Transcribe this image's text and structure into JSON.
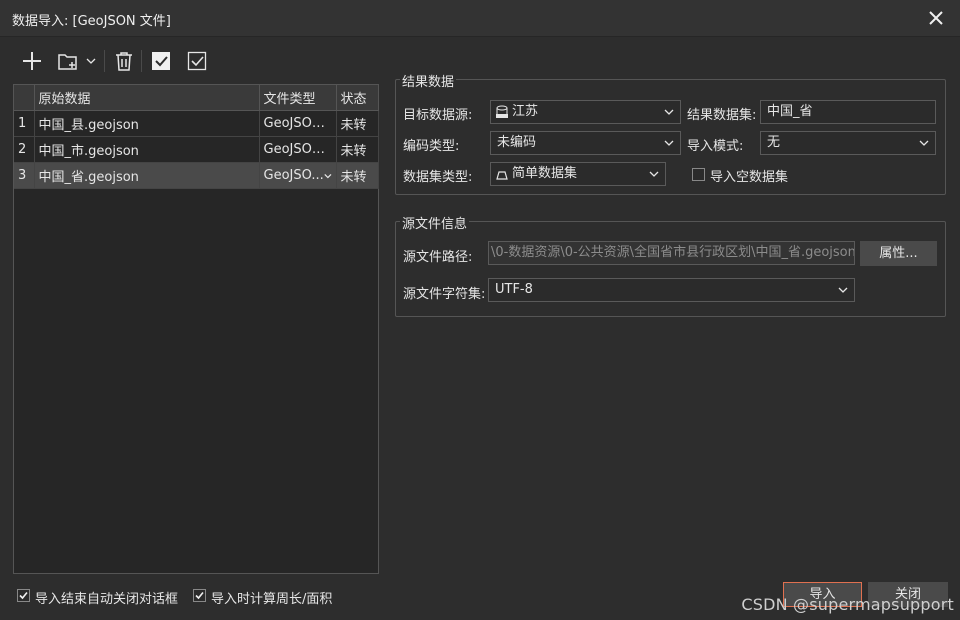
{
  "window": {
    "title": "数据导入: [GeoJSON 文件]"
  },
  "toolbar": {
    "icons": [
      "add-icon",
      "add-folder-icon",
      "chevron-down-icon",
      "delete-icon",
      "select-all-icon",
      "invert-select-icon"
    ]
  },
  "file_table": {
    "headers": [
      "",
      "原始数据",
      "文件类型",
      "状态"
    ],
    "rows": [
      {
        "index": "1",
        "name": "中国_县.geojson",
        "type": "GeoJSON...",
        "status": "未转"
      },
      {
        "index": "2",
        "name": "中国_市.geojson",
        "type": "GeoJSON...",
        "status": "未转"
      },
      {
        "index": "3",
        "name": "中国_省.geojson",
        "type": "GeoJSO...",
        "status": "未转"
      }
    ]
  },
  "result_group": {
    "legend": "结果数据",
    "target_datasource_label": "目标数据源:",
    "target_datasource_value": "江苏",
    "result_dataset_label": "结果数据集:",
    "result_dataset_value": "中国_省",
    "encoding_label": "编码类型:",
    "encoding_value": "未编码",
    "import_mode_label": "导入模式:",
    "import_mode_value": "无",
    "dataset_type_label": "数据集类型:",
    "dataset_type_value": "简单数据集",
    "import_empty_label": "导入空数据集"
  },
  "source_group": {
    "legend": "源文件信息",
    "path_label": "源文件路径:",
    "path_value": "\\0-数据资源\\0-公共资源\\全国省市县行政区划\\中国_省.geojson",
    "properties_button": "属性...",
    "charset_label": "源文件字符集:",
    "charset_value": "UTF-8"
  },
  "footer": {
    "auto_close_label": "导入结束自动关闭对话框",
    "calc_perimeter_label": "导入时计算周长/面积",
    "import_button": "导入",
    "close_button": "关闭",
    "watermark": "CSDN @supermapsupport"
  },
  "colors": {
    "background": "#2d2d2d",
    "accent_border": "#e07050"
  }
}
